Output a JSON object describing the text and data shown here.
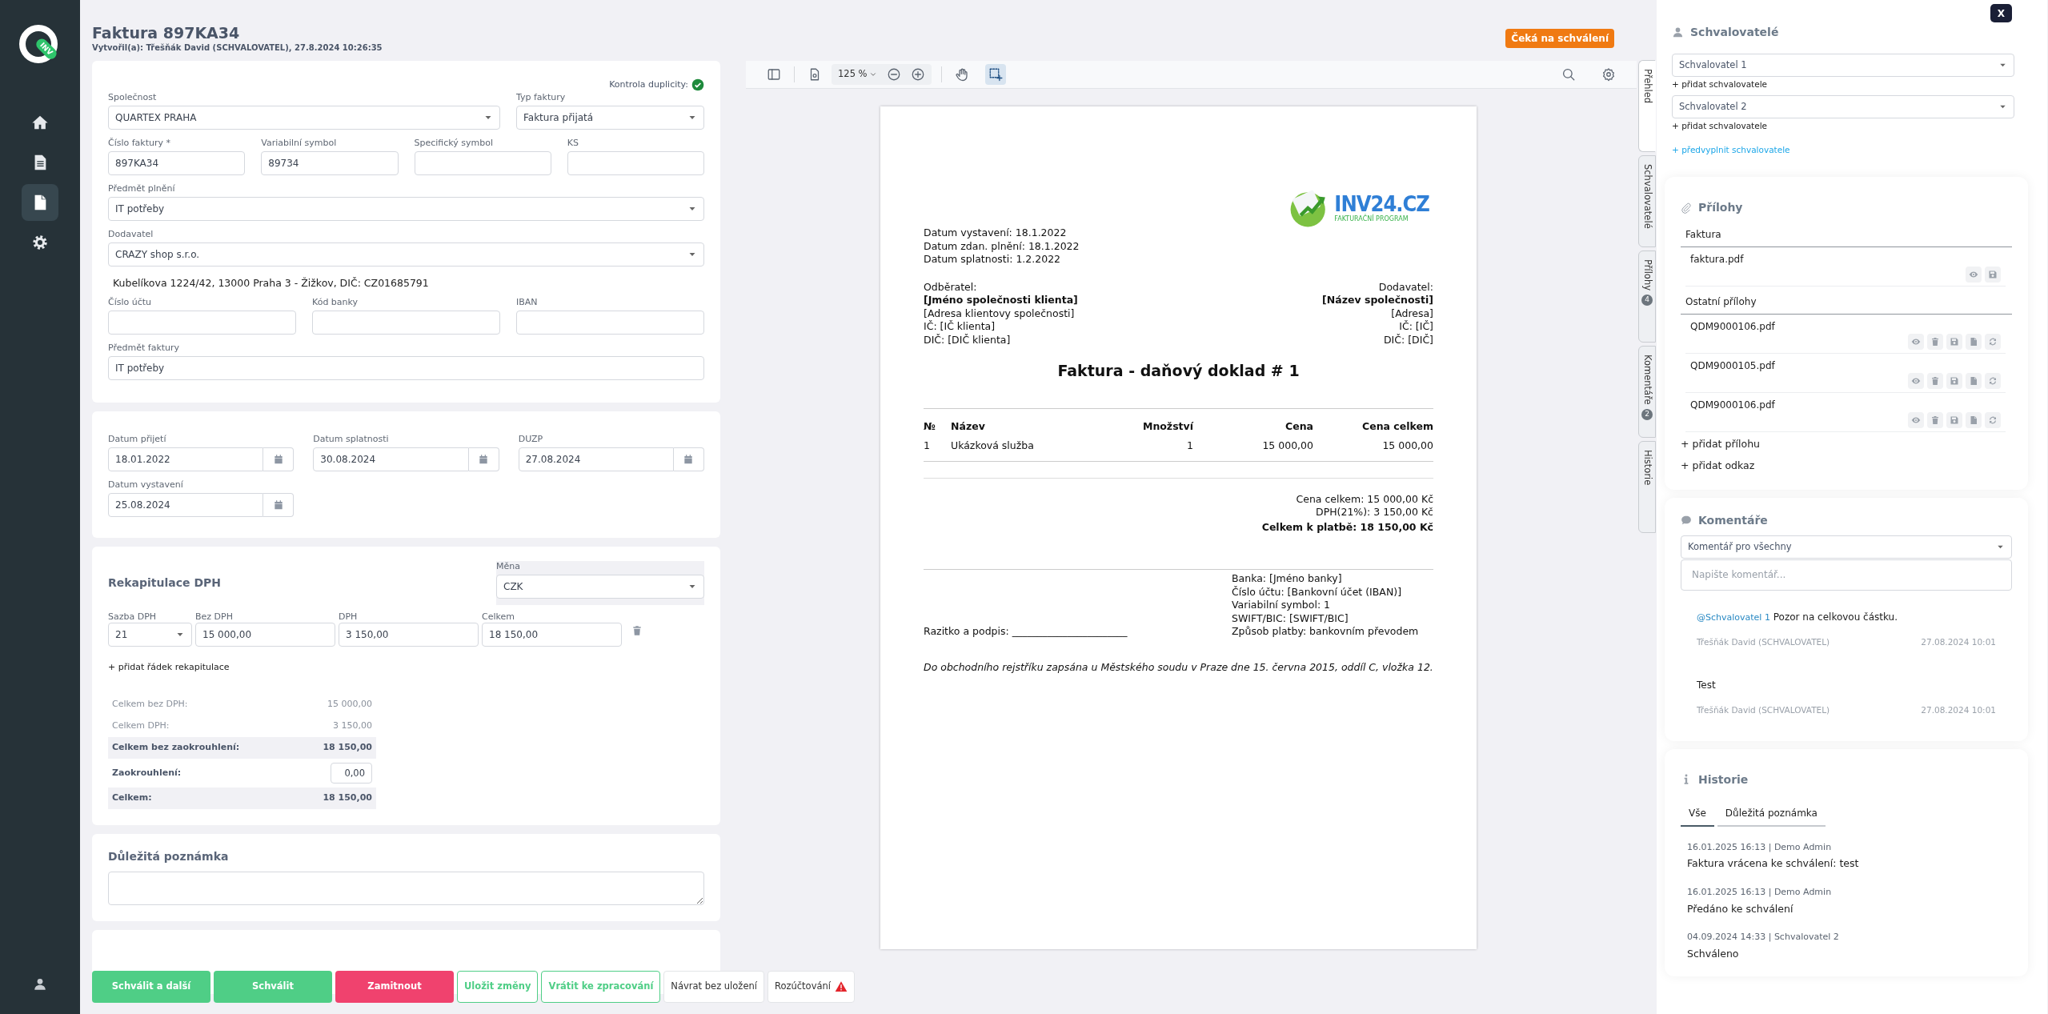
{
  "sidebar": {
    "logo_text": "INV",
    "items": [
      {
        "kind": "home",
        "selected": false
      },
      {
        "kind": "list",
        "selected": false
      },
      {
        "kind": "file",
        "selected": true
      },
      {
        "kind": "settings",
        "selected": false
      }
    ]
  },
  "header": {
    "title": "Faktura 897KA34",
    "subtitle": "Vytvořil(a): Třešňák David (SCHVALOVATEL), 27.8.2024 10:26:35",
    "status": "Čeká na schválení"
  },
  "invoice_card": {
    "duplicity_label": "Kontrola duplicity:",
    "duplicity_ok": true,
    "fields": [
      {
        "kind": "select",
        "label": "Společnost",
        "value": "QUARTEX PRAHA"
      },
      {
        "kind": "select",
        "label": "Typ faktury",
        "value": "Faktura přijatá"
      },
      {
        "kind": "input",
        "label": "Číslo faktury *",
        "value": "897KA34"
      },
      {
        "kind": "input",
        "label": "Variabilní symbol",
        "value": "89734"
      },
      {
        "kind": "input",
        "label": "Specifický symbol"
      },
      {
        "kind": "input",
        "label": "KS"
      },
      {
        "kind": "select",
        "label": "Předmět plnění",
        "value": "IT potřeby"
      },
      {
        "kind": "select",
        "label": "Dodavatel",
        "value": "CRAZY shop s.r.o."
      },
      {
        "kind": "note",
        "value": "Kubelíkova 1224/42, 13000 Praha 3 - Žižkov, DIČ: CZ01685791"
      },
      {
        "kind": "input",
        "label": "Číslo účtu"
      },
      {
        "kind": "input",
        "label": "Kód banky"
      },
      {
        "kind": "input",
        "label": "IBAN"
      },
      {
        "kind": "input",
        "label": "Předmět faktury",
        "value": "IT potřeby"
      }
    ]
  },
  "dates_card": {
    "fields": [
      {
        "label": "Datum přijetí",
        "value": "18.01.2022"
      },
      {
        "label": "Datum splatnosti",
        "value": "30.08.2024"
      },
      {
        "label": "DUZP",
        "value": "27.08.2024"
      },
      {
        "label": "Datum vystavení",
        "value": "25.08.2024"
      }
    ]
  },
  "vat_card": {
    "title": "Rekapitulace DPH",
    "currency": {
      "label": "Měna",
      "value": "CZK"
    },
    "columns": [
      "Sazba DPH",
      "Bez DPH",
      "DPH",
      "Celkem"
    ],
    "rows": [
      {
        "rate": "21",
        "base": "15 000,00",
        "vat": "3 150,00",
        "total": "18 150,00"
      }
    ],
    "add_row": "+ přidat řádek rekapitulace",
    "summary": [
      {
        "kind": "plain",
        "label": "Celkem bez DPH:",
        "value": "15 000,00"
      },
      {
        "kind": "plain",
        "label": "Celkem DPH:",
        "value": "3 150,00"
      },
      {
        "kind": "shaded",
        "label": "Celkem bez zaokrouhlení:",
        "value": "18 150,00"
      },
      {
        "kind": "input",
        "label": "Zaokrouhlení:",
        "value": "0,00"
      },
      {
        "kind": "shaded",
        "label": "Celkem:",
        "value": "18 150,00"
      }
    ]
  },
  "note_card": {
    "title": "Důležitá poznámka"
  },
  "actions": [
    {
      "label": "Schválit a další",
      "kind": "success",
      "warning": false
    },
    {
      "label": "Schválit",
      "kind": "success",
      "warning": false
    },
    {
      "label": "Zamitnout",
      "kind": "danger",
      "warning": false
    },
    {
      "label": "Uložit změny",
      "kind": "outline",
      "warning": false
    },
    {
      "label": "Vrátit ke zpracování",
      "kind": "outline",
      "warning": false
    },
    {
      "label": "Návrat bez uložení",
      "kind": "light",
      "warning": false
    },
    {
      "label": "Rozúčtování",
      "kind": "light",
      "warning": true
    }
  ],
  "viewer": {
    "zoom": "125 %",
    "tools": [
      {
        "kind": "hand",
        "selected": false
      },
      {
        "kind": "select",
        "selected": true
      }
    ],
    "document": {
      "logo_name": "INV24.CZ",
      "logo_tagline": "FAKTURAČNÍ PROGRAM",
      "dates": [
        "Datum vystavení: 18.1.2022",
        "Datum zdan. plnění: 18.1.2022",
        "Datum splatnosti: 1.2.2022"
      ],
      "buyer": {
        "label": "Odběratel:",
        "name": "[Jméno společnosti klienta]",
        "lines": [
          "[Adresa klientovy společnosti]",
          "IČ: [IČ klienta]",
          "DIČ: [DIČ klienta]"
        ]
      },
      "supplier": {
        "label": "Dodavatel:",
        "name": "[Název společnosti]",
        "lines": [
          "[Adresa]",
          "IČ: [IČ]",
          "DIČ: [DIČ]"
        ]
      },
      "title": "Faktura - daňový doklad # 1",
      "columns": [
        "№",
        "Název",
        "Množství",
        "Cena",
        "Cena celkem"
      ],
      "rows": [
        [
          "1",
          "Ukázková služba",
          "1",
          "15 000,00",
          "15 000,00"
        ]
      ],
      "totals": [
        "Cena celkem: 15 000,00 Kč",
        "DPH(21%): 3 150,00 Kč"
      ],
      "grand_total": "Celkem k platbě: 18 150,00 Kč",
      "signature": "Razitko a podpis: _______________________",
      "bank": [
        "Banka: [Jméno banky]",
        "Číslo účtu: [Bankovní účet (IBAN)]",
        "Variabilní symbol: 1",
        "SWIFT/BIC: [SWIFT/BIC]",
        "Způsob platby: bankovním převodem"
      ],
      "footer": "Do obchodního rejstříku zapsána u Městského soudu v Praze dne 15. června 2015, oddíl C, vložka 12."
    }
  },
  "side_tabs": [
    {
      "label": "Přehled",
      "selected": true
    },
    {
      "label": "Schvalovatelé",
      "selected": false
    },
    {
      "label": "Přílohy",
      "badge": "4",
      "selected": false
    },
    {
      "label": "Komentáře",
      "badge": "2",
      "selected": false
    },
    {
      "label": "Historie",
      "selected": false
    }
  ],
  "panel": {
    "close": "X",
    "approvers": {
      "title": "Schvalovatelé",
      "items": [
        {
          "value": "Schvalovatel 1",
          "add": "+ přidat schvalovatele"
        },
        {
          "value": "Schvalovatel 2",
          "add": "+ přidat schvalovatele"
        }
      ],
      "prefill": "+ předvyplnit schvalovatele"
    },
    "attachments": {
      "title": "Přílohy",
      "groups": [
        {
          "title": "Faktura",
          "files": [
            {
              "name": "faktura.pdf",
              "kind": "invoice"
            }
          ]
        },
        {
          "title": "Ostatní přílohy",
          "files": [
            {
              "name": "QDM9000106.pdf",
              "kind": "attachment"
            },
            {
              "name": "QDM9000105.pdf",
              "kind": "attachment"
            },
            {
              "name": "QDM9000106.pdf",
              "kind": "attachment"
            }
          ]
        }
      ],
      "links": [
        "+ přidat přílohu",
        "+ přidat odkaz"
      ]
    },
    "comments": {
      "title": "Komentáře",
      "audience": "Komentář pro všechny",
      "placeholder": "Napište komentář...",
      "items": [
        {
          "mention": "@Schvalovatel 1",
          "text": "Pozor na celkovou částku.",
          "author": "Třešňák David (SCHVALOVATEL)",
          "time": "27.08.2024 10:01"
        },
        {
          "text": "Test",
          "author": "Třešňák David (SCHVALOVATEL)",
          "time": "27.08.2024 10:01"
        }
      ]
    },
    "history": {
      "title": "Historie",
      "tabs": [
        {
          "label": "Vše",
          "selected": true
        },
        {
          "label": "Důležitá poznámka",
          "selected": false
        }
      ],
      "items": [
        {
          "meta": "16.01.2025 16:13 | Demo Admin",
          "text": "Faktura vrácena ke schválení: test"
        },
        {
          "meta": "16.01.2025 16:13 | Demo Admin",
          "text": "Předáno ke schválení"
        },
        {
          "meta": "04.09.2024 14:33 | Schvalovatel 2",
          "text": "Schváleno"
        }
      ]
    }
  }
}
